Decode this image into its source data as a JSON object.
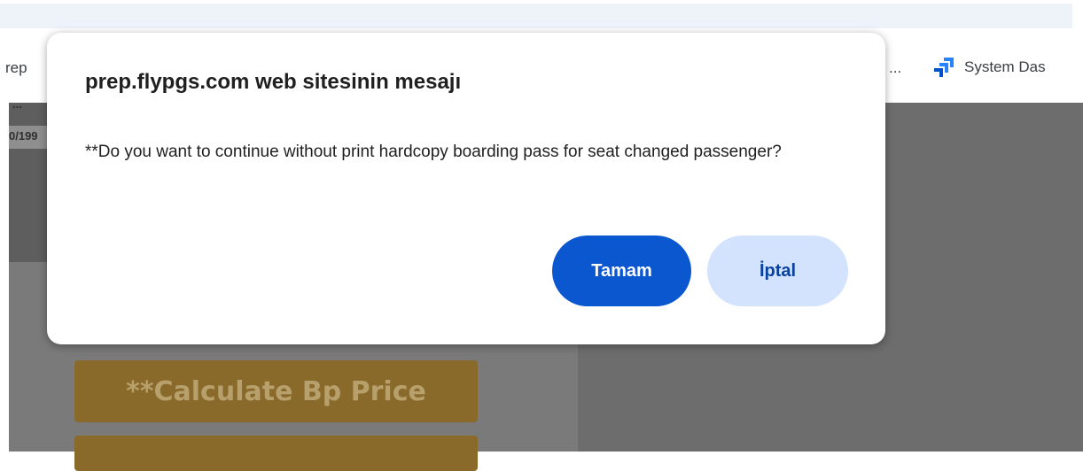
{
  "bookmarks": {
    "left_truncated": "rep",
    "ellipsis": "...",
    "system_dashboard": "System Das"
  },
  "page": {
    "label_small": "...",
    "date_fragment": "0/199",
    "calculate_button": "**Calculate Bp Price"
  },
  "dialog": {
    "title": "prep.flypgs.com web sitesinin mesajı",
    "message": "**Do you want to continue without print hardcopy boarding pass for seat changed passenger?",
    "ok_label": "Tamam",
    "cancel_label": "İptal"
  },
  "colors": {
    "ok_button": "#0b57d0",
    "cancel_button": "#d3e3fd",
    "calculate_button": "#8a6a2a",
    "jira_blue": "#2684ff"
  }
}
